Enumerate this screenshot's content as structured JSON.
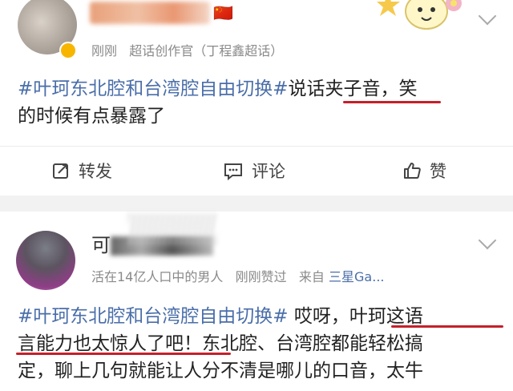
{
  "post1": {
    "meta_time": "刚刚",
    "meta_source": "超话创作官（丁程鑫超话）",
    "flag": "🇨🇳",
    "text_line1_topic": "#叶珂东北腔和台湾腔自由切换#",
    "text_line1_rest": "说话夹子音，笑",
    "text_line2": "的时候有点暴露了",
    "actions": {
      "repost": "转发",
      "comment": "评论",
      "like": "赞"
    }
  },
  "post2": {
    "name_visible": "可",
    "meta_user": "活在14亿人口中的男人",
    "meta_liked": "刚刚赞过",
    "meta_from": "来自",
    "meta_device": "三星Ga...",
    "text_line1_topic": "#叶珂东北腔和台湾腔自由切换#",
    "text_line1_rest": " 哎呀，叶珂这语",
    "text_line2": "言能力也太惊人了吧！东北腔、台湾腔都能轻松搞",
    "text_line3": "定，聊上几句就能让人分不清是哪儿的口音，太牛"
  },
  "colors": {
    "topic": "#4a6ea9",
    "underline": "#c4202a",
    "separator": "#f2f2f2"
  }
}
